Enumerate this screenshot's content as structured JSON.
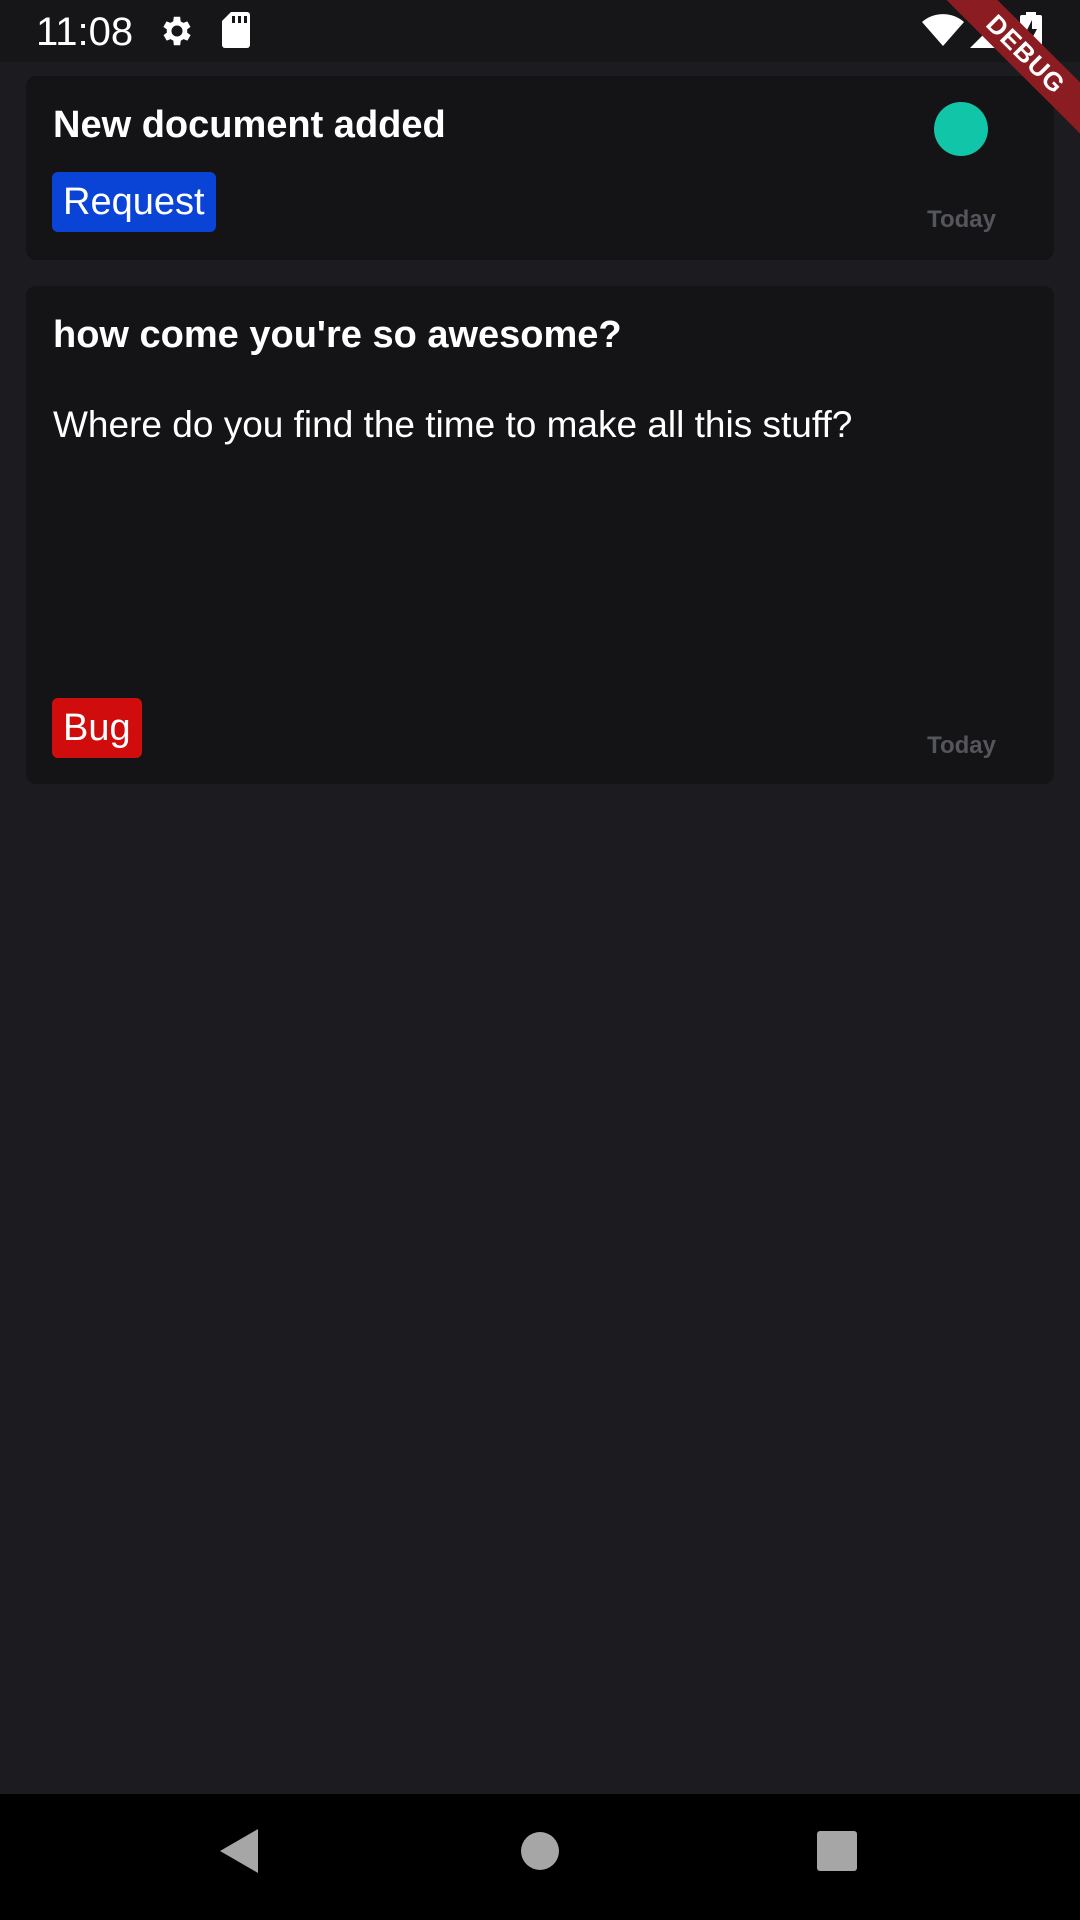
{
  "status_bar": {
    "time": "11:08",
    "icons": [
      "gear-icon",
      "sd-card-icon",
      "wifi-icon",
      "signal-icon",
      "battery-charging-icon"
    ]
  },
  "debug_banner": {
    "label": "DEBUG",
    "color": "#8b1c22"
  },
  "cards": [
    {
      "title": "New document added",
      "body": "",
      "tag": {
        "label": "Request",
        "color": "#0a44d6"
      },
      "date": "Today",
      "dot_color": "#11c6a8"
    },
    {
      "title": "how come you're so awesome?",
      "body": "Where do you find the time to make all this stuff?",
      "tag": {
        "label": "Bug",
        "color": "#d10c0c"
      },
      "date": "Today"
    }
  ],
  "nav_bar": {
    "buttons": [
      "back-icon",
      "home-icon",
      "recents-icon"
    ]
  },
  "colors": {
    "background": "#1c1c20",
    "card": "#141417",
    "muted_text": "#55565c"
  }
}
